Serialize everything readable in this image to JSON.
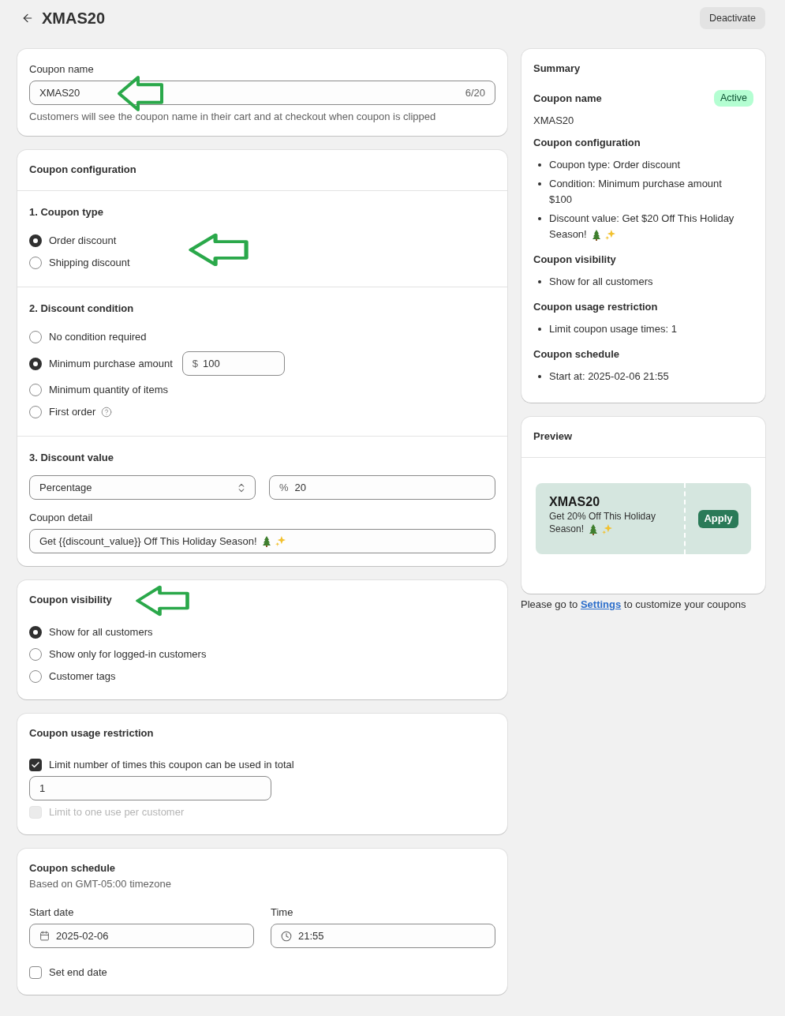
{
  "header": {
    "title": "XMAS20",
    "action": "Deactivate"
  },
  "coupon_name": {
    "label": "Coupon name",
    "value": "XMAS20",
    "counter": "6/20",
    "help": "Customers will see the coupon name in their cart and at checkout when coupon is clipped"
  },
  "coupon_configuration": {
    "title": "Coupon configuration",
    "sections": [
      {
        "kind": "radio",
        "title": "1. Coupon type",
        "options": [
          {
            "label": "Order discount",
            "selected": true
          },
          {
            "label": "Shipping discount",
            "selected": false
          }
        ]
      },
      {
        "kind": "radio",
        "title": "2. Discount condition",
        "options": [
          {
            "label": "No condition required",
            "selected": false
          },
          {
            "label": "Minimum purchase amount",
            "selected": true,
            "input": {
              "prefix": "$",
              "value": "100"
            }
          },
          {
            "label": "Minimum quantity of items",
            "selected": false
          },
          {
            "label": "First order",
            "selected": false,
            "help_icon": true
          }
        ]
      },
      {
        "kind": "value",
        "title": "3. Discount value",
        "type_select": {
          "value": "Percentage"
        },
        "amount": {
          "prefix": "%",
          "value": "20"
        },
        "detail": {
          "label": "Coupon detail",
          "value": "Get {{discount_value}} Off This Holiday Season!",
          "trailing_emoji": true
        }
      }
    ]
  },
  "coupon_visibility": {
    "title": "Coupon visibility",
    "options": [
      {
        "label": "Show for all customers",
        "selected": true
      },
      {
        "label": "Show only for logged-in customers",
        "selected": false
      },
      {
        "label": "Customer tags",
        "selected": false
      }
    ]
  },
  "usage_restriction": {
    "title": "Coupon usage restriction",
    "limit_total": {
      "label": "Limit number of times this coupon can be used in total",
      "checked": true,
      "value": "1"
    },
    "per_customer": {
      "label": "Limit to one use per customer",
      "checked": false,
      "disabled": true
    }
  },
  "schedule": {
    "title": "Coupon schedule",
    "subtitle": "Based on GMT-05:00 timezone",
    "start_date": {
      "label": "Start date",
      "value": "2025-02-06"
    },
    "time": {
      "label": "Time",
      "value": "21:55"
    },
    "end_date": {
      "label": "Set end date",
      "checked": false
    }
  },
  "summary": {
    "title": "Summary",
    "sections": [
      {
        "kind": "value",
        "title": "Coupon name",
        "badge": "Active",
        "value": "XMAS20"
      },
      {
        "kind": "list",
        "title": "Coupon configuration",
        "items": [
          {
            "text": "Coupon type: Order discount",
            "trailing_emoji": false
          },
          {
            "text": "Condition: Minimum purchase amount $100",
            "trailing_emoji": false
          },
          {
            "text": "Discount value: Get $20 Off This Holiday Season!",
            "trailing_emoji": true
          }
        ]
      },
      {
        "kind": "list",
        "title": "Coupon visibility",
        "items": [
          {
            "text": "Show for all customers",
            "trailing_emoji": false
          }
        ]
      },
      {
        "kind": "list",
        "title": "Coupon usage restriction",
        "items": [
          {
            "text": "Limit coupon usage times: 1",
            "trailing_emoji": false
          }
        ]
      },
      {
        "kind": "list",
        "title": "Coupon schedule",
        "items": [
          {
            "text": "Start at: 2025-02-06 21:55",
            "trailing_emoji": false
          }
        ]
      }
    ]
  },
  "preview": {
    "title": "Preview",
    "coupon": {
      "code": "XMAS20",
      "description": "Get 20% Off This Holiday Season!",
      "trailing_emoji": true,
      "action": "Apply"
    },
    "note": {
      "before": "Please go to",
      "link": "Settings",
      "after": "to customize your coupons"
    }
  }
}
